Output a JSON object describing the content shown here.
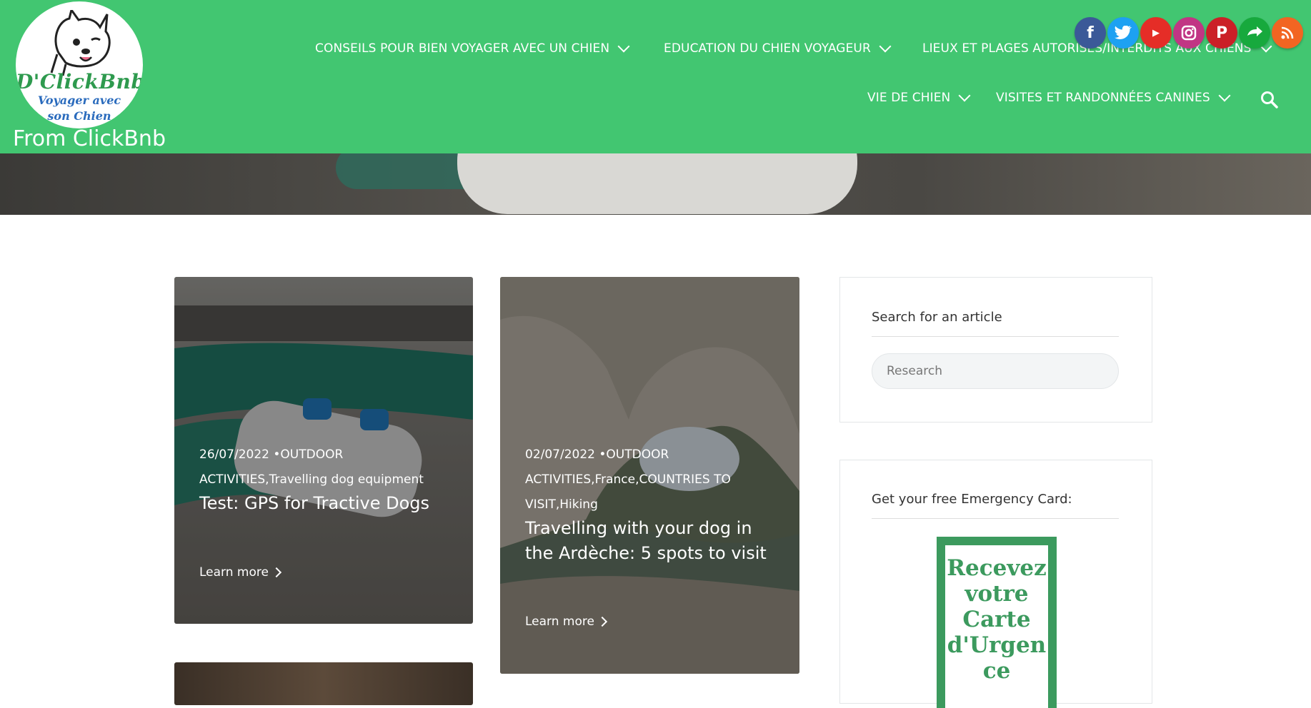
{
  "site": {
    "logo_brand": "D'ClickBnb",
    "logo_tagline_1": "Voyager avec",
    "logo_tagline_2": "son Chien",
    "title": "From ClickBnb"
  },
  "nav": {
    "items": [
      {
        "label": "CONSEILS POUR BIEN VOYAGER AVEC UN CHIEN"
      },
      {
        "label": "EDUCATION DU CHIEN VOYAGEUR"
      },
      {
        "label": "LIEUX ET PLAGES AUTORISÉS/INTERDITS AUX CHIENS"
      },
      {
        "label": "VIE DE CHIEN"
      },
      {
        "label": "VISITES ET RANDONNÉES CANINES"
      }
    ],
    "search_icon": "search-icon"
  },
  "socials": [
    {
      "name": "facebook-icon",
      "color": "#3b5998"
    },
    {
      "name": "twitter-icon",
      "color": "#1da1f2"
    },
    {
      "name": "youtube-icon",
      "color": "#e52d27"
    },
    {
      "name": "instagram-icon",
      "color": "#c13584"
    },
    {
      "name": "pinterest-icon",
      "color": "#cb2027"
    },
    {
      "name": "follow-icon",
      "color": "#17a93d"
    },
    {
      "name": "rss-icon",
      "color": "#f26522"
    }
  ],
  "posts": [
    {
      "date_category_1": "26/07/2022 •OUTDOOR",
      "date_category_2": "ACTIVITIES,Travelling dog equipment",
      "title": "Test: GPS for Tractive Dogs",
      "more": "Learn more"
    },
    {
      "date_category_1": "02/07/2022 •OUTDOOR",
      "date_category_2": "ACTIVITIES,France,COUNTRIES TO",
      "date_category_3": "VISIT,Hiking",
      "title_1": "Travelling with your dog in",
      "title_2": "the Ardèche: 5 spots to visit",
      "more": "Learn more"
    }
  ],
  "sidebar": {
    "search_title": "Search for an article",
    "search_placeholder": "Research",
    "emergency_title": "Get your free Emergency Card:",
    "emergency_card_text": [
      "Recevez",
      "votre",
      "Carte",
      "d'Urgen",
      "ce"
    ]
  },
  "colors": {
    "header_bg": "#42c671",
    "accent_green": "#3c9a5e"
  }
}
